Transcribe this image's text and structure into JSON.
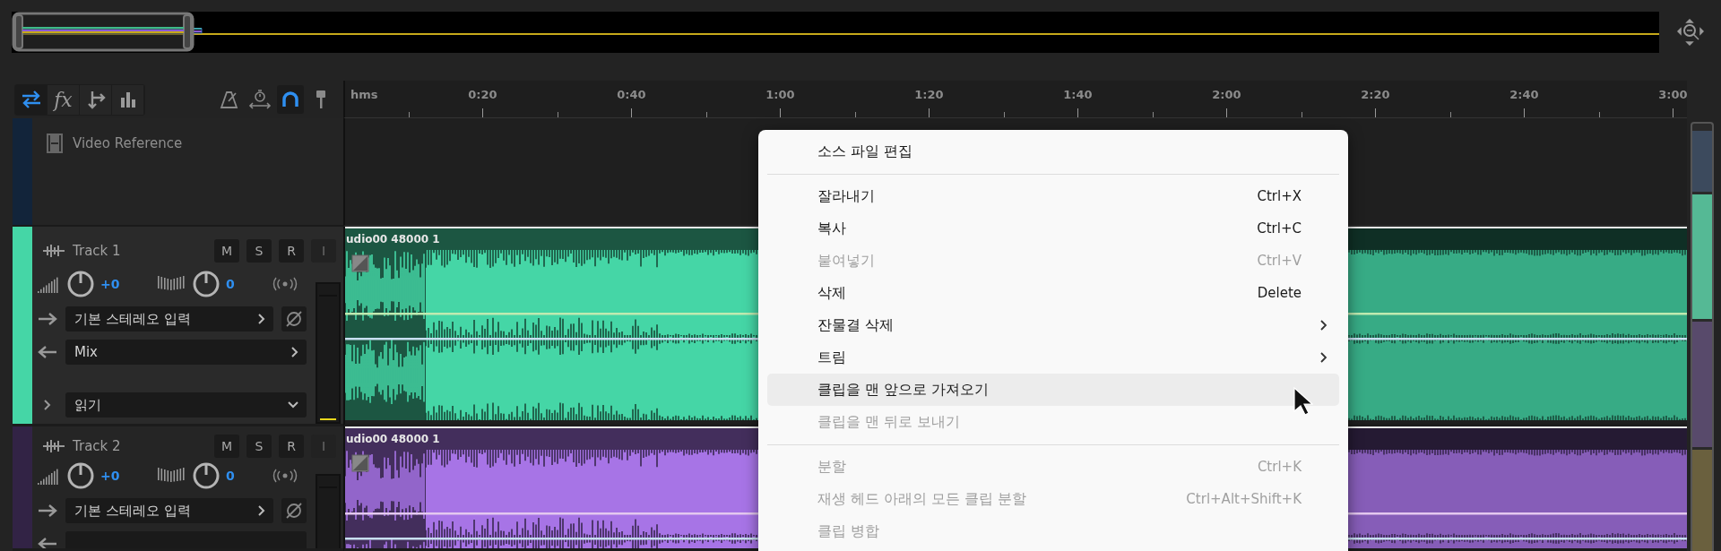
{
  "toolbar": {
    "view_buttons": [
      {
        "kind": "arrows",
        "selected": true
      },
      {
        "kind": "fx",
        "label": "fx",
        "selected": false
      },
      {
        "kind": "sends",
        "selected": false
      },
      {
        "kind": "eq",
        "selected": false
      }
    ],
    "tool_buttons": [
      {
        "kind": "metronome",
        "selected": false
      },
      {
        "kind": "stretch",
        "selected": false
      },
      {
        "kind": "snap",
        "selected": true
      },
      {
        "kind": "pin",
        "selected": false
      }
    ]
  },
  "ruler": {
    "unit": "hms",
    "labels": [
      "0:20",
      "0:40",
      "1:00",
      "1:20",
      "1:40",
      "2:00",
      "2:20",
      "2:40",
      "3:00"
    ]
  },
  "video_track": {
    "name": "Video Reference"
  },
  "tracks": [
    {
      "name": "Track 1",
      "color": "#45d6a6",
      "selected": true,
      "volume": "+0",
      "pan": "0",
      "input": "기본 스테레오 입력",
      "output": "Mix",
      "automation": "읽기",
      "buttons": [
        {
          "label": "M",
          "disabled": false
        },
        {
          "label": "S",
          "disabled": false
        },
        {
          "label": "R",
          "disabled": false
        },
        {
          "label": "I",
          "disabled": true
        }
      ],
      "clip": {
        "title": "udio00 48000 1"
      }
    },
    {
      "name": "Track 2",
      "color": "#a774e6",
      "selected": false,
      "volume": "+0",
      "pan": "0",
      "input": "기본 스테레오 입력",
      "buttons": [
        {
          "label": "M",
          "disabled": false
        },
        {
          "label": "S",
          "disabled": false
        },
        {
          "label": "R",
          "disabled": false
        },
        {
          "label": "I",
          "disabled": true
        }
      ],
      "clip": {
        "title": "udio00 48000 1"
      }
    }
  ],
  "menu": {
    "items": [
      {
        "kind": "item",
        "label": "소스 파일 편집",
        "disabled": false,
        "highlighted": false,
        "submenu": false
      },
      {
        "kind": "separator"
      },
      {
        "kind": "item",
        "label": "잘라내기",
        "shortcut": "Ctrl+X",
        "disabled": false,
        "highlighted": false,
        "submenu": false
      },
      {
        "kind": "item",
        "label": "복사",
        "shortcut": "Ctrl+C",
        "disabled": false,
        "highlighted": false,
        "submenu": false
      },
      {
        "kind": "item",
        "label": "붙여넣기",
        "shortcut": "Ctrl+V",
        "disabled": true,
        "highlighted": false,
        "submenu": false
      },
      {
        "kind": "item",
        "label": "삭제",
        "shortcut": "Delete",
        "disabled": false,
        "highlighted": false,
        "submenu": false
      },
      {
        "kind": "item",
        "label": "잔물결 삭제",
        "disabled": false,
        "highlighted": false,
        "submenu": true
      },
      {
        "kind": "item",
        "label": "트림",
        "disabled": false,
        "highlighted": false,
        "submenu": true
      },
      {
        "kind": "item",
        "label": "클립을 맨 앞으로 가져오기",
        "disabled": false,
        "highlighted": true,
        "submenu": false
      },
      {
        "kind": "item",
        "label": "클립을 맨 뒤로 보내기",
        "disabled": true,
        "highlighted": false,
        "submenu": false
      },
      {
        "kind": "separator"
      },
      {
        "kind": "item",
        "label": "분할",
        "shortcut": "Ctrl+K",
        "disabled": true,
        "highlighted": false,
        "submenu": false
      },
      {
        "kind": "item",
        "label": "재생 헤드 아래의 모든 클립 분할",
        "shortcut": "Ctrl+Alt+Shift+K",
        "disabled": true,
        "highlighted": false,
        "submenu": false
      },
      {
        "kind": "item",
        "label": "클립 병합",
        "disabled": true,
        "highlighted": false,
        "submenu": false
      }
    ]
  }
}
